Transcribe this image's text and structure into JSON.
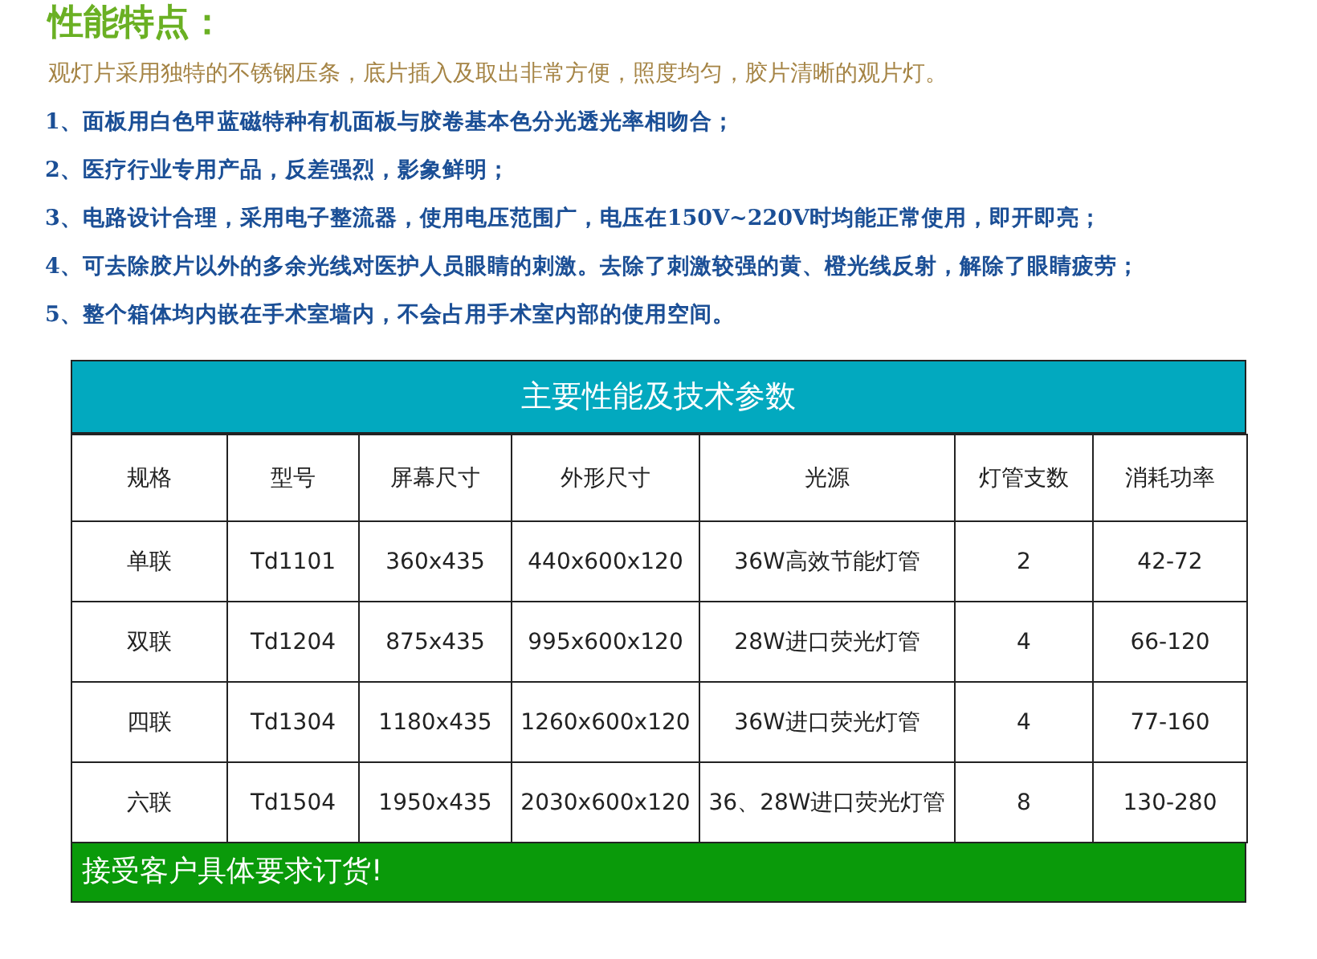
{
  "title": "性能特点：",
  "intro": "观灯片采用独特的不锈钢压条，底片插入及取出非常方便，照度均匀，胶片清晰的观片灯。",
  "features": [
    "1、面板用白色甲蓝磁特种有机面板与胶卷基本色分光透光率相吻合；",
    "2、医疗行业专用产品，反差强烈，影象鲜明；",
    "3、电路设计合理，采用电子整流器，使用电压范围广，电压在150V~220V时均能正常使用，即开即亮；",
    "4、可去除胶片以外的多余光线对医护人员眼睛的刺激。去除了刺激较强的黄、橙光线反射，解除了眼睛疲劳；",
    "5、整个箱体均内嵌在手术室墙内，不会占用手术室内部的使用空间。"
  ],
  "table": {
    "title": "主要性能及技术参数",
    "columns": [
      "规格",
      "型号",
      "屏幕尺寸",
      "外形尺寸",
      "光源",
      "灯管支数",
      "消耗功率"
    ],
    "rows": [
      [
        "单联",
        "Td1101",
        "360x435",
        "440x600x120",
        "36W高效节能灯管",
        "2",
        "42-72"
      ],
      [
        "双联",
        "Td1204",
        "875x435",
        "995x600x120",
        "28W进口荧光灯管",
        "4",
        "66-120"
      ],
      [
        "四联",
        "Td1304",
        "1180x435",
        "1260x600x120",
        "36W进口荧光灯管",
        "4",
        "77-160"
      ],
      [
        "六联",
        "Td1504",
        "1950x435",
        "2030x600x120",
        "36、28W进口荧光灯管",
        "8",
        "130-280"
      ]
    ],
    "footer": "接受客户具体要求订货!"
  }
}
